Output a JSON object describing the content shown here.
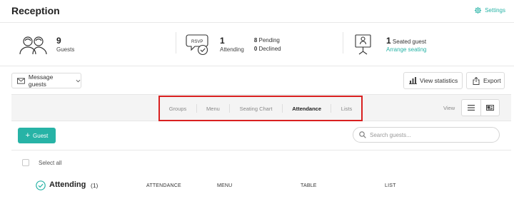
{
  "header": {
    "title": "Reception",
    "settings_label": "Settings"
  },
  "stats": {
    "guests": {
      "count": "9",
      "label": "Guests"
    },
    "attending": {
      "count": "1",
      "label": "Attending",
      "pending_count": "8",
      "pending_label": "Pending",
      "declined_count": "0",
      "declined_label": "Declined",
      "rsvp_text": "RSVP"
    },
    "seated": {
      "count": "1",
      "label": "Seated guest",
      "link": "Arrange seating"
    }
  },
  "toolbar": {
    "message_label": "Message guests",
    "statistics_label": "View statistics",
    "export_label": "Export"
  },
  "tabs": [
    {
      "label": "Groups",
      "active": false
    },
    {
      "label": "Menu",
      "active": false
    },
    {
      "label": "Seating Chart",
      "active": false
    },
    {
      "label": "Attendance",
      "active": true
    },
    {
      "label": "Lists",
      "active": false
    }
  ],
  "view": {
    "label": "View"
  },
  "guest": {
    "add_label": "Guest",
    "search_placeholder": "Search guests..."
  },
  "list": {
    "select_all": "Select all",
    "group_title": "Attending",
    "group_count": "(1)",
    "columns": [
      "ATTENDANCE",
      "MENU",
      "TABLE",
      "LIST"
    ]
  },
  "colors": {
    "accent": "#27b3a6",
    "highlight": "#d92020"
  }
}
